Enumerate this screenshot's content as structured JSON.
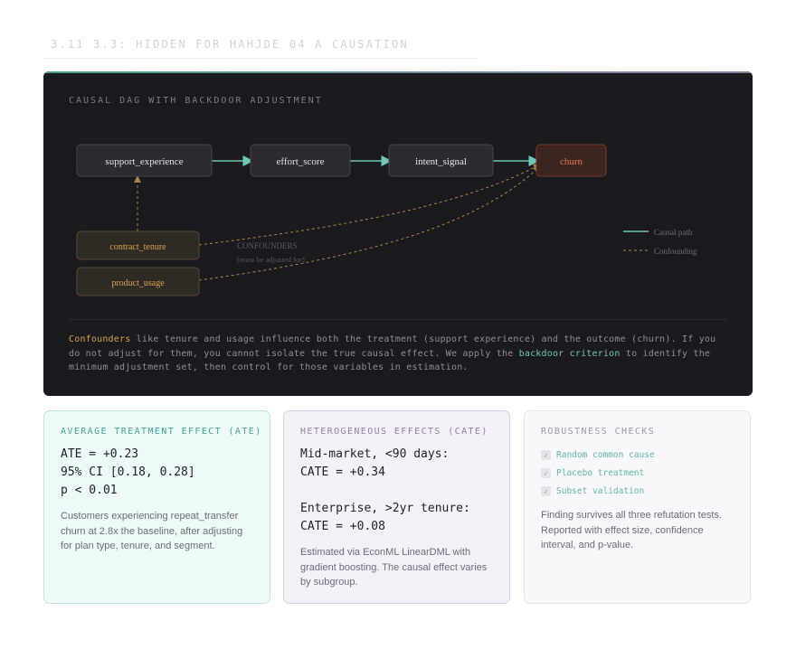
{
  "page": {
    "heading": "3.11 3.3: HIDDEN FOR HAHJDE 04 A CAUSATION"
  },
  "dag": {
    "title": "CAUSAL DAG WITH BACKDOOR ADJUSTMENT",
    "nodes": {
      "support_experience": "support_experience",
      "effort_score": "effort_score",
      "intent_signal": "intent_signal",
      "churn": "churn",
      "contract_tenure": "contract_tenure",
      "product_usage": "product_usage"
    },
    "confounders_label": "CONFOUNDERS",
    "confounders_note": "(must be adjusted for)",
    "legend": {
      "causal": "Causal path",
      "confounding": "Confounding"
    },
    "colors": {
      "causal": "#6cc7b5",
      "confounding": "#a8874a",
      "churn": "#e0784e",
      "confounder_text": "#d9a14a"
    }
  },
  "explanation": {
    "part1": "Confounders",
    "part2": " like tenure and usage influence both the treatment (support experience) and the outcome (churn). If you do not adjust for them, you cannot isolate the true causal effect. We apply the ",
    "part3": "backdoor criterion",
    "part4": " to identify the minimum adjustment set, then control for those variables in estimation."
  },
  "ate": {
    "title": "AVERAGE TREATMENT EFFECT (ATE)",
    "line1": "ATE = +0.23",
    "line2": "95% CI [0.18, 0.28]",
    "line3": "p < 0.01",
    "description": "Customers experiencing repeat_transfer churn at 2.8x the baseline, after adjusting for plan type, tenure, and segment."
  },
  "cate": {
    "title": "HETEROGENEOUS EFFECTS (CATE)",
    "line1": "Mid-market, <90 days:",
    "line2": "CATE = +0.34",
    "line3": "Enterprise, >2yr tenure:",
    "line4": "CATE = +0.08",
    "description": "Estimated via EconML LinearDML with gradient boosting. The causal effect varies by subgroup."
  },
  "robustness": {
    "title": "ROBUSTNESS CHECKS",
    "checks": [
      "Random common cause",
      "Placebo treatment",
      "Subset validation"
    ],
    "check_mark": "✓",
    "description": "Finding survives all three refutation tests. Reported with effect size, confidence interval, and p-value."
  }
}
